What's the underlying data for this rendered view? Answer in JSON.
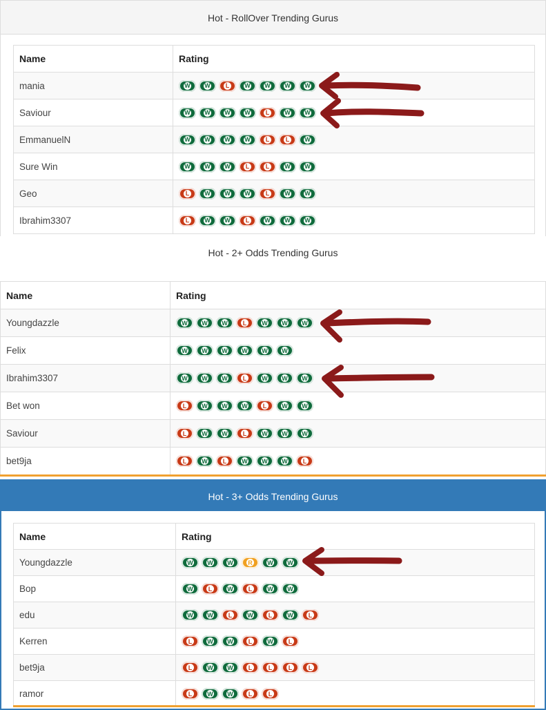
{
  "colors": {
    "win": "#0f6b3c",
    "loss": "#c83a17",
    "refund": "#f0a020",
    "arrow": "#8b1a1a",
    "accent_blue": "#337ab7",
    "accent_orange": "#f0a030"
  },
  "sections": [
    {
      "title": "Hot - RollOver Trending Gurus",
      "header_name": "Name",
      "header_rating": "Rating",
      "rows": [
        {
          "name": "mania",
          "rating": [
            "W",
            "W",
            "L",
            "W",
            "W",
            "W",
            "W"
          ]
        },
        {
          "name": "Saviour",
          "rating": [
            "W",
            "W",
            "W",
            "W",
            "L",
            "W",
            "W"
          ]
        },
        {
          "name": "EmmanuelN",
          "rating": [
            "W",
            "W",
            "W",
            "W",
            "L",
            "L",
            "W"
          ]
        },
        {
          "name": "Sure Win",
          "rating": [
            "W",
            "W",
            "W",
            "L",
            "L",
            "W",
            "W"
          ]
        },
        {
          "name": "Geo",
          "rating": [
            "L",
            "W",
            "W",
            "W",
            "L",
            "W",
            "W"
          ]
        },
        {
          "name": "Ibrahim3307",
          "rating": [
            "L",
            "W",
            "W",
            "L",
            "W",
            "W",
            "W"
          ]
        }
      ]
    },
    {
      "title": "Hot - 2+ Odds Trending Gurus",
      "header_name": "Name",
      "header_rating": "Rating",
      "rows": [
        {
          "name": "Youngdazzle",
          "rating": [
            "W",
            "W",
            "W",
            "L",
            "W",
            "W",
            "W"
          ]
        },
        {
          "name": "Felix",
          "rating": [
            "W",
            "W",
            "W",
            "W",
            "W",
            "W"
          ]
        },
        {
          "name": "Ibrahim3307",
          "rating": [
            "W",
            "W",
            "W",
            "L",
            "W",
            "W",
            "W"
          ]
        },
        {
          "name": "Bet won",
          "rating": [
            "L",
            "W",
            "W",
            "W",
            "L",
            "W",
            "W"
          ]
        },
        {
          "name": "Saviour",
          "rating": [
            "L",
            "W",
            "W",
            "L",
            "W",
            "W",
            "W"
          ]
        },
        {
          "name": "bet9ja",
          "rating": [
            "L",
            "W",
            "L",
            "W",
            "W",
            "W",
            "L"
          ]
        }
      ]
    },
    {
      "title": "Hot - 3+ Odds Trending Gurus",
      "header_name": "Name",
      "header_rating": "Rating",
      "rows": [
        {
          "name": "Youngdazzle",
          "rating": [
            "W",
            "W",
            "W",
            "R",
            "W",
            "W"
          ]
        },
        {
          "name": "Bop",
          "rating": [
            "W",
            "L",
            "W",
            "L",
            "W",
            "W"
          ]
        },
        {
          "name": "edu",
          "rating": [
            "W",
            "W",
            "L",
            "W",
            "L",
            "W",
            "L"
          ]
        },
        {
          "name": "Kerren",
          "rating": [
            "L",
            "W",
            "W",
            "L",
            "W",
            "L"
          ]
        },
        {
          "name": "bet9ja",
          "rating": [
            "L",
            "W",
            "W",
            "L",
            "L",
            "L",
            "L"
          ]
        },
        {
          "name": "ramor",
          "rating": [
            "L",
            "W",
            "W",
            "L",
            "L"
          ]
        }
      ]
    }
  ]
}
